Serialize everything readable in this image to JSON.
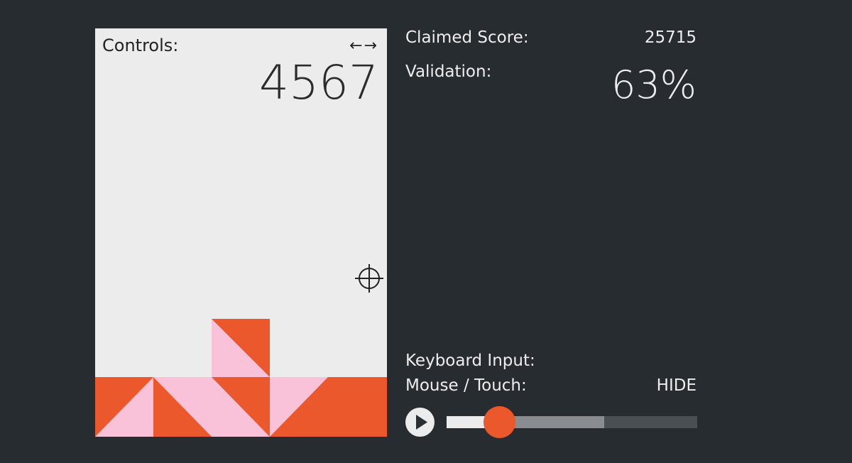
{
  "board": {
    "controls_label": "Controls:",
    "arrows": "←→",
    "score": "4567",
    "colors": {
      "background": "#ececec",
      "orange": "#ea582b",
      "pink": "#f9c2d9"
    }
  },
  "panel": {
    "claimed_score_label": "Claimed Score:",
    "claimed_score_value": "25715",
    "validation_label": "Validation:",
    "validation_value": "63%",
    "keyboard_input_label": "Keyboard Input:",
    "mouse_touch_label": "Mouse / Touch:",
    "hide_label": "HIDE"
  },
  "player": {
    "play_icon": "play-icon",
    "progress": 0.21,
    "buffered": 0.63
  },
  "icons": {
    "crosshair": "crosshair-icon"
  }
}
